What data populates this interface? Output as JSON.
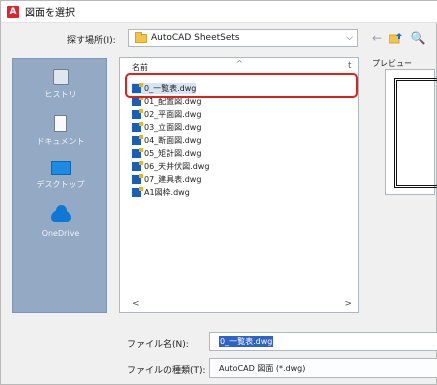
{
  "window": {
    "app_icon": "A",
    "title": "図面を選択"
  },
  "lookin": {
    "label": "探す場所(I):",
    "value": "AutoCAD SheetSets",
    "arrow": "⌵"
  },
  "toolbar": {
    "back_icon": "←",
    "up_icon": "folder-up-icon",
    "search_icon": "🔍"
  },
  "places": [
    {
      "label": "ヒストリ",
      "icon": "history-icon"
    },
    {
      "label": "ドキュメント",
      "icon": "documents-icon"
    },
    {
      "label": "デスクトップ",
      "icon": "desktop-icon"
    },
    {
      "label": "OneDrive",
      "icon": "onedrive-icon"
    }
  ],
  "filelist": {
    "column_name": "名前",
    "sort_indicator": "^",
    "column_t": "t",
    "files": [
      "0_一覧表.dwg",
      "01_配置図.dwg",
      "02_平面図.dwg",
      "03_立面図.dwg",
      "04_断面図.dwg",
      "05_矩計図.dwg",
      "06_天井伏図.dwg",
      "07_建具表.dwg",
      "A1図枠.dwg"
    ],
    "selected_index": 0,
    "scroll_left": "<",
    "scroll_right": ">"
  },
  "preview": {
    "label": "プレビュー"
  },
  "filename": {
    "label": "ファイル名(N):",
    "value": "0_一覧表.dwg"
  },
  "filetype": {
    "label": "ファイルの種類(T):",
    "value": "AutoCAD 図面 (*.dwg)"
  },
  "colors": {
    "highlight": "#e21f1f",
    "places_bg": "#93a9c4",
    "selection": "#2f63c7"
  }
}
